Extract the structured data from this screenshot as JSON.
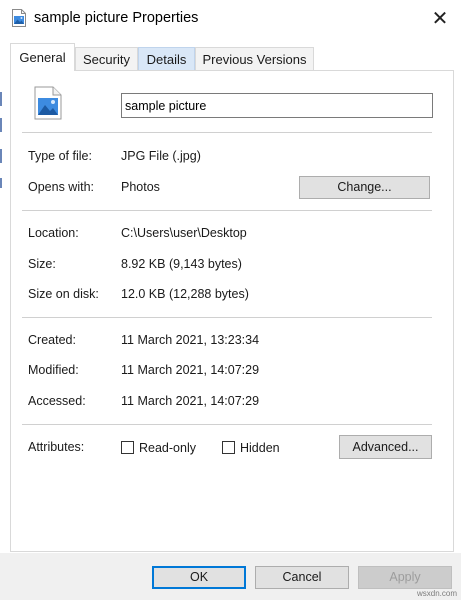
{
  "window": {
    "title": "sample picture Properties",
    "close_symbol": "✕"
  },
  "tabs": [
    {
      "label": "General",
      "active": true
    },
    {
      "label": "Security",
      "active": false
    },
    {
      "label": "Details",
      "active": false,
      "highlighted": true
    },
    {
      "label": "Previous Versions",
      "active": false
    }
  ],
  "file": {
    "icon": "image-file-icon",
    "name_value": "sample picture"
  },
  "type_section": {
    "type_label": "Type of file:",
    "type_value": "JPG File (.jpg)",
    "opens_label": "Opens with:",
    "opens_value": "Photos",
    "change_button": "Change..."
  },
  "location_section": {
    "location_label": "Location:",
    "location_value": "C:\\Users\\user\\Desktop",
    "size_label": "Size:",
    "size_value": "8.92 KB (9,143 bytes)",
    "size_on_disk_label": "Size on disk:",
    "size_on_disk_value": "12.0 KB (12,288 bytes)"
  },
  "dates_section": {
    "created_label": "Created:",
    "created_value": "11 March 2021, 13:23:34",
    "modified_label": "Modified:",
    "modified_value": "11 March 2021, 14:07:29",
    "accessed_label": "Accessed:",
    "accessed_value": "11 March 2021, 14:07:29"
  },
  "attributes": {
    "label": "Attributes:",
    "readonly_label": "Read-only",
    "readonly_checked": false,
    "hidden_label": "Hidden",
    "hidden_checked": false,
    "advanced_button": "Advanced..."
  },
  "footer": {
    "ok": "OK",
    "cancel": "Cancel",
    "apply": "Apply"
  },
  "watermark": "wsxdn.com",
  "colors": {
    "accent": "#0078d7",
    "tab_highlight": "#d9e7f7",
    "footer_bg": "#f0f0f0"
  }
}
